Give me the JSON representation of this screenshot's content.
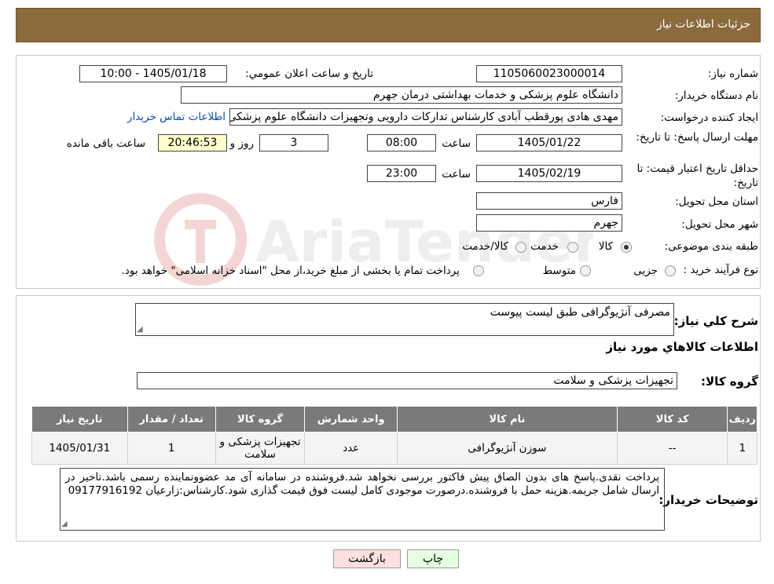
{
  "header": {
    "title": "جزئیات اطلاعات نیاز"
  },
  "form": {
    "need_no_label": "شماره نیاز:",
    "need_no": "1105060023000014",
    "announce_label": "تاریخ و ساعت اعلان عمومي:",
    "announce": "1405/01/18 - 10:00",
    "buyer_label": "نام دستگاه خریدار:",
    "buyer": "دانشگاه علوم پزشکی و خدمات بهداشتی  درمان جهرم",
    "creator_label": "ایجاد کننده درخواست:",
    "creator": "مهدی هادی پورقطب آبادی کارشناس تدارکات دارویی وتجهیزات دانشگاه علوم پزشکی",
    "contact_link": "اطلاعات تماس خریدار",
    "deadline_label": "مهلت ارسال پاسخ: تا تاریخ:",
    "deadline_date": "1405/01/22",
    "time_label": "ساعت",
    "deadline_time": "08:00",
    "days": "3",
    "days_label": "روز و",
    "remaining": "20:46:53",
    "remaining_label": "ساعت باقی مانده",
    "validity_label": "حداقل تاریخ اعتبار قیمت: تا تاریخ:",
    "validity_date": "1405/02/19",
    "validity_time": "23:00",
    "province_label": "استان محل تحویل:",
    "province": "فارس",
    "city_label": "شهر محل تحویل:",
    "city": "جهرم",
    "category_label": "طبقه بندی موضوعی:",
    "category_options": [
      "کالا",
      "خدمت",
      "کالا/خدمت"
    ],
    "process_label": "نوع فرآیند خرید :",
    "process_options": [
      "جزیی",
      "متوسط"
    ],
    "process_note": "پرداخت تمام یا بخشی از مبلغ خرید،از محل \"اسناد خزانه اسلامی\" خواهد بود."
  },
  "summary": {
    "desc_label": "شرح کلي نياز:",
    "desc": "مصرفی آنژیوگرافی طبق لیست پیوست",
    "goods_title": "اطلاعات کالاهاي مورد نياز",
    "group_label": "گروه کالا:",
    "group": "تجهیزات پزشکی و سلامت"
  },
  "table": {
    "headers": [
      "رديف",
      "کد کالا",
      "نام کالا",
      "واحد شمارش",
      "گروه کالا",
      "تعداد / مقدار",
      "تاريخ نياز"
    ],
    "rows": [
      [
        "1",
        "--",
        "سوزن آنژیوگرافی",
        "عدد",
        "تجهیزات پزشکی و سلامت",
        "1",
        "1405/01/31"
      ]
    ]
  },
  "notes": {
    "label": "توضیحات خریدار:",
    "text": "پرداخت نقدی.پاسخ های بدون الصاق پیش فاکتور بررسی نخواهد شد.فروشنده در سامانه آی مد عضوونماینده رسمی باشد.تاخیر در ارسال شامل جریمه.هزینه حمل با فروشنده.درصورت موجودی کامل لیست فوق قیمت گذاری شود.کارشناس:زارعیان 09177916192"
  },
  "buttons": {
    "print": "چاپ",
    "back": "بازگشت"
  },
  "watermark": {
    "text": "AriaTender.neT"
  },
  "colors": {
    "header": "#8b6a3c",
    "table_header": "#7a7a7a",
    "link": "#0a4db8",
    "back_button": "#ffe0e0",
    "print_button": "#e6ffe0"
  }
}
